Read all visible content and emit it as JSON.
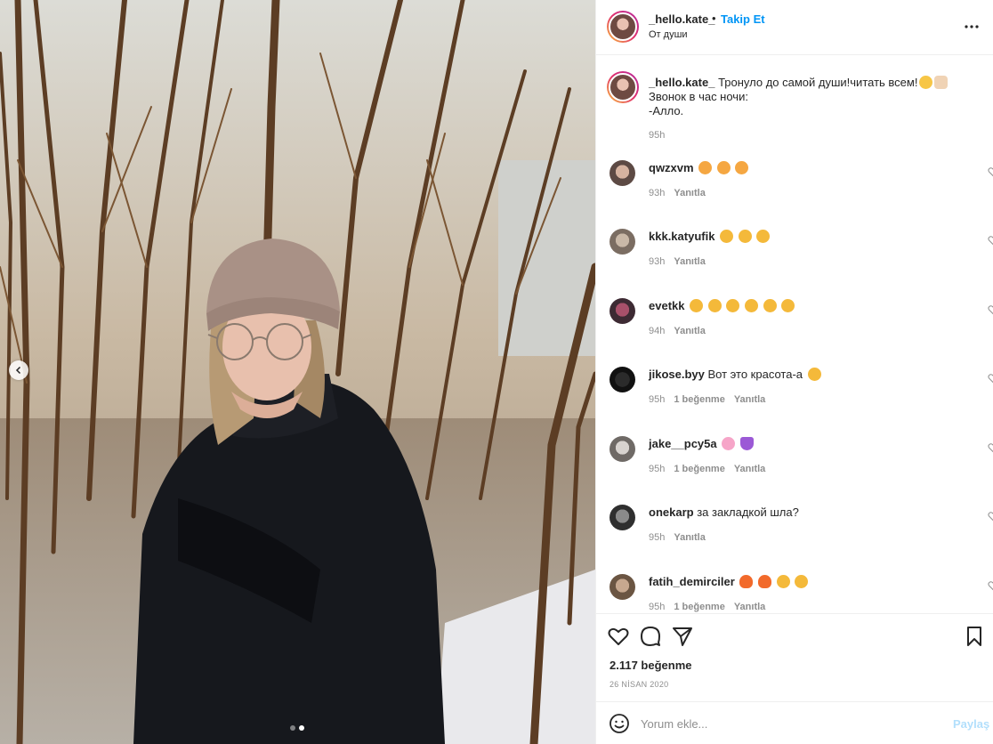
{
  "post": {
    "username": "_hello.kate_",
    "follow_label": "Takip Et",
    "location": "От души",
    "more_icon": "more-horizontal-icon"
  },
  "caption": {
    "username": "_hello.kate_",
    "line1": "Тронуло до самой души!читать всем!",
    "line2": "Звонок в час ночи:",
    "line3": "-Алло.",
    "time": "95h"
  },
  "comments": [
    {
      "user": "qwzxvm",
      "text": "",
      "emoji": [
        "cat",
        "cat",
        "cat"
      ],
      "time": "93h",
      "likes": "",
      "reply": "Yanıtla"
    },
    {
      "user": "kkk.katyufik",
      "text": "",
      "emoji": [
        "heart-eyes",
        "heart-eyes",
        "heart-eyes"
      ],
      "time": "93h",
      "likes": "",
      "reply": "Yanıtla"
    },
    {
      "user": "evetkk",
      "text": "",
      "emoji": [
        "heart-eyes",
        "heart-eyes",
        "heart-eyes",
        "heart-eyes",
        "heart-eyes",
        "heart-eyes"
      ],
      "time": "94h",
      "likes": "",
      "reply": "Yanıtla"
    },
    {
      "user": "jikose.byy",
      "text": "Вот это красота-а",
      "emoji": [
        "heart-eyes"
      ],
      "time": "95h",
      "likes": "1 beğenme",
      "reply": "Yanıtla"
    },
    {
      "user": "jake__pcy5a",
      "text": "",
      "emoji": [
        "flower",
        "purple-heart"
      ],
      "time": "95h",
      "likes": "1 beğenme",
      "reply": "Yanıtla"
    },
    {
      "user": "onekarp",
      "text": "за закладкой шла?",
      "emoji": [],
      "time": "95h",
      "likes": "",
      "reply": "Yanıtla"
    },
    {
      "user": "fatih_demirciler",
      "text": "",
      "emoji": [
        "fire",
        "fire",
        "astonished",
        "astonished"
      ],
      "time": "95h",
      "likes": "1 beğenme",
      "reply": "Yanıtla"
    }
  ],
  "stats": {
    "likes": "2.117 beğenme",
    "date": "26 NİSAN 2020"
  },
  "add_comment": {
    "placeholder": "Yorum ekle...",
    "share_label": "Paylaş"
  },
  "colors": {
    "link": "#0095f6",
    "muted": "#8e8e8e",
    "text": "#262626"
  }
}
